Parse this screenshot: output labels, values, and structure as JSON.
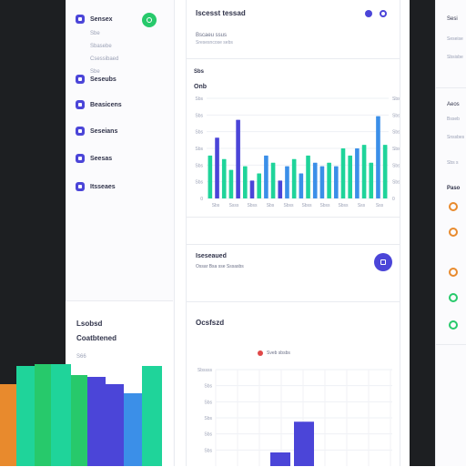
{
  "sidebar": {
    "items": [
      {
        "label": "Sensex",
        "sub": false,
        "icon": "square-icon"
      },
      {
        "label": "Sbe",
        "sub": true
      },
      {
        "label": "Sbasebe",
        "sub": true
      },
      {
        "label": "Csessibaed",
        "sub": true
      },
      {
        "label": "Sbe",
        "sub": true
      },
      {
        "label": "Seseubs",
        "sub": false,
        "icon": "square-icon"
      },
      {
        "label": "Beasicens",
        "sub": false,
        "icon": "square-icon"
      },
      {
        "label": "Seseians",
        "sub": false,
        "icon": "square-icon"
      },
      {
        "label": "Seesas",
        "sub": false,
        "icon": "square-icon"
      },
      {
        "label": "Itsseaes",
        "sub": false,
        "icon": "square-icon"
      }
    ],
    "bottom_title": "Lsobsd",
    "bottom_subtitle": "Coatbtened",
    "bottom_small": "S66"
  },
  "main": {
    "title": "Iscesst tessad",
    "subtitle": "Bscaeu ssus",
    "subtitle2": "Sresesncose sebs",
    "chart_label": "Sbs",
    "chart_title": "Onb",
    "footer_title": "Iseseaued",
    "footer_sub": "Ossar Bsa sse Sssasbs",
    "section_title": "Ocsfszd",
    "legend_label": "Sveb sbsbs"
  },
  "right": {
    "t1": "Sesi",
    "t2": "Seseise",
    "t3": "Sbsisbe",
    "t4": "Aeos",
    "t5": "Bsseb",
    "t6": "Snssbes",
    "t7": "Sbs s",
    "t8": "Paso"
  },
  "colors": {
    "accent": "#4b45d8",
    "green": "#27c96b",
    "teal": "#1fd49a",
    "blue": "#3b8fe8",
    "orange": "#e88a2d",
    "red": "#e04848"
  },
  "chart_data": {
    "type": "bar",
    "categories": [
      "Sbs",
      "Ssss",
      "Sbss",
      "Sbs",
      "Sbss",
      "Sbss",
      "Sbss",
      "Sbss",
      "Sss",
      "Sss"
    ],
    "values": [
      60,
      85,
      55,
      40,
      110,
      45,
      25,
      35,
      60,
      50,
      25,
      45,
      55,
      35,
      60,
      50,
      45,
      50,
      45,
      70,
      60,
      70,
      75,
      50,
      115,
      75
    ],
    "ytick_labels": [
      "0",
      "Sbs",
      "Sbs",
      "Sbs",
      "Sbs",
      "Sbs",
      "Sbs"
    ],
    "ylim": [
      0,
      140
    ]
  },
  "bottom_chart": {
    "type": "bar",
    "values": [
      20,
      65
    ],
    "ytick_labels": [
      "Sbssss",
      "Sbs",
      "Sbs",
      "Sbs",
      "Sbs",
      "Sbs"
    ]
  },
  "big_bars": {
    "values": [
      90,
      110,
      112,
      112,
      100,
      98,
      90,
      80,
      110
    ]
  }
}
